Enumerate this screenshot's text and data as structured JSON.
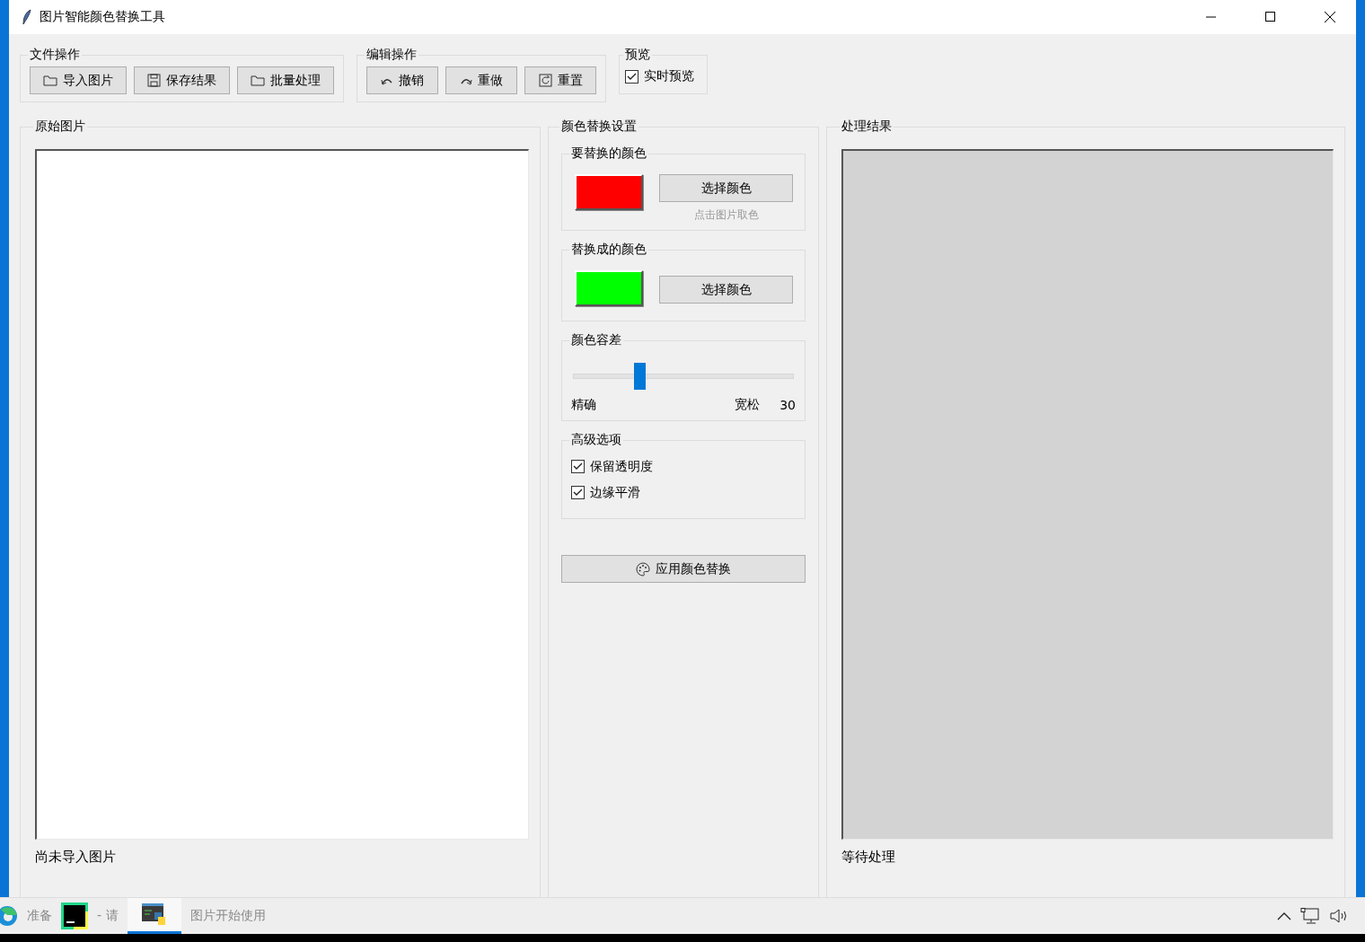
{
  "window": {
    "title": "图片智能颜色替换工具"
  },
  "toolbar_groups": [
    {
      "title": "文件操作",
      "buttons": [
        {
          "label": "导入图片"
        },
        {
          "label": "保存结果"
        },
        {
          "label": "批量处理"
        }
      ]
    },
    {
      "title": "编辑操作",
      "buttons": [
        {
          "label": "撤销"
        },
        {
          "label": "重做"
        },
        {
          "label": "重置"
        }
      ]
    }
  ],
  "preview": {
    "title": "预览",
    "checkbox": {
      "label": "实时预览",
      "checked": true
    }
  },
  "original_panel": {
    "title": "原始图片",
    "status": "尚未导入图片"
  },
  "settings": {
    "title": "颜色替换设置",
    "source_color": {
      "title": "要替换的颜色",
      "color": "#ff0000",
      "button": "选择颜色",
      "hint": "点击图片取色"
    },
    "target_color": {
      "title": "替换成的颜色",
      "color": "#00ff00",
      "button": "选择颜色"
    },
    "tolerance": {
      "title": "颜色容差",
      "level": 0.3,
      "min_label": "精确",
      "max_label": "宽松",
      "value": "30"
    },
    "advanced": {
      "title": "高级选项",
      "options": [
        {
          "label": "保留透明度",
          "checked": true
        },
        {
          "label": "边缘平滑",
          "checked": true
        }
      ]
    },
    "apply_button": "应用颜色替换"
  },
  "result_panel": {
    "title": "处理结果",
    "status": "等待处理"
  },
  "status_bar": {
    "fragments": [
      "准备",
      "- 请",
      "图片开始使用"
    ]
  }
}
